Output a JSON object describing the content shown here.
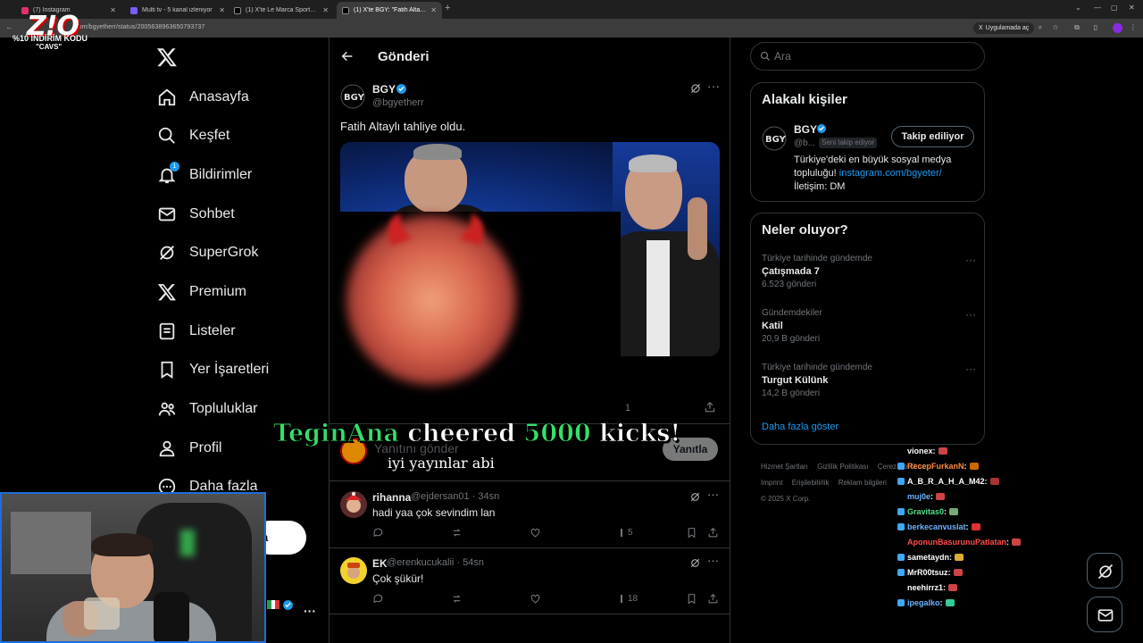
{
  "browser": {
    "tabs": [
      {
        "label": "(7) Instagram",
        "color": "#e1306c",
        "active": false
      },
      {
        "label": "Multi tv - 5 kanal izleniyor",
        "color": "#7b5cff",
        "active": false
      },
      {
        "label": "(1) X'te Le Marca Sports: \"Erden...",
        "color": "#ffffff",
        "active": false
      },
      {
        "label": "(1) X'te BGY: \"Fatih Altaylı tahliy...",
        "color": "#ffffff",
        "active": true
      }
    ],
    "url": ".com/bgyetherr/status/2005638963650793737",
    "translate_chip": "Uygulamada aç"
  },
  "overlay_logo": {
    "line1": "%10 İNDİRİM KODU",
    "line2": "\"CAVS\""
  },
  "nav": {
    "items": [
      {
        "label": "Anasayfa",
        "icon": "home-icon"
      },
      {
        "label": "Keşfet",
        "icon": "search-icon"
      },
      {
        "label": "Bildirimler",
        "icon": "bell-icon",
        "badge": "1"
      },
      {
        "label": "Sohbet",
        "icon": "mail-icon"
      },
      {
        "label": "SuperGrok",
        "icon": "grok-icon"
      },
      {
        "label": "Premium",
        "icon": "x-icon"
      },
      {
        "label": "Listeler",
        "icon": "list-icon"
      },
      {
        "label": "Yer İşaretleri",
        "icon": "bookmark-icon"
      },
      {
        "label": "Topluluklar",
        "icon": "people-icon"
      },
      {
        "label": "Profil",
        "icon": "user-icon"
      },
      {
        "label": "Daha fazla",
        "icon": "more-circle-icon"
      }
    ],
    "post_button_partial": "a"
  },
  "main": {
    "header_title": "Gönderi",
    "post": {
      "name": "BGY",
      "handle": "@bgyetherr",
      "text": "Fatih Altaylı tahliye oldu.",
      "views": "1"
    },
    "reply_placeholder": "Yanıtını gönder",
    "reply_button": "Yanıtla",
    "replies": [
      {
        "name": "rihanna",
        "handle": "@ejdersan01",
        "time": "· 34sn",
        "text": "hadi yaa çok sevindim lan",
        "views": "5"
      },
      {
        "name": "EK",
        "handle": "@erenkucukalii",
        "time": "· 54sn",
        "text": "Çok şükür!",
        "views": "18"
      }
    ]
  },
  "cheer": {
    "user": "TeginAna",
    "word1": "cheered",
    "amount": "5000",
    "word2": "kicks!",
    "message": "iyi yayınlar abi"
  },
  "right": {
    "search_placeholder": "Ara",
    "related": {
      "title": "Alakalı kişiler",
      "name": "BGY",
      "handle": "@b...",
      "follows_you": "Seni takip ediyor",
      "follow_button": "Takip ediliyor",
      "bio1": "Türkiye'deki en büyük sosyal medya",
      "bio2": "topluluğu!",
      "bio_link": "instagram.com/bgyeter/",
      "bio3": "İletişim: DM"
    },
    "trends": {
      "title": "Neler oluyor?",
      "items": [
        {
          "context": "Türkiye tarihinde gündemde",
          "name": "Çatışmada 7",
          "count": "6.523 gönderi"
        },
        {
          "context": "Gündemdekiler",
          "name": "Katil",
          "count": "20,9 B gönderi"
        },
        {
          "context": "Türkiye tarihinde gündemde",
          "name": "Turgut Külünk",
          "count": "14,2 B gönderi"
        }
      ],
      "show_more": "Daha fazla göster"
    },
    "footer": [
      "Hizmet Şartları",
      "Gizlilik Politikası",
      "Çerez Politikası",
      "Imprint",
      "Erişilebilirlik",
      "Reklam bilgileri",
      "© 2025 X Corp."
    ]
  },
  "chat": [
    {
      "user": "vionex",
      "color": "#ffffff"
    },
    {
      "user": "RecepFurkanN",
      "color": "#ff8a3d"
    },
    {
      "user": "A_B_R_A_H_A_M42",
      "color": "#ffffff"
    },
    {
      "user": "muj0e",
      "color": "#6fb3ff"
    },
    {
      "user": "Gravitas0",
      "color": "#4fe28c"
    },
    {
      "user": "berkecanvuslat",
      "color": "#6fb3ff"
    },
    {
      "user": "AponunBasurunuPatlatan",
      "color": "#ff4d4d"
    },
    {
      "user": "sametaydn",
      "color": "#ffffff"
    },
    {
      "user": "MrR00tsuz",
      "color": "#ffffff"
    },
    {
      "user": "neehirrz1",
      "color": "#ffffff"
    },
    {
      "user": "ipegalko",
      "color": "#6fb3ff"
    }
  ]
}
